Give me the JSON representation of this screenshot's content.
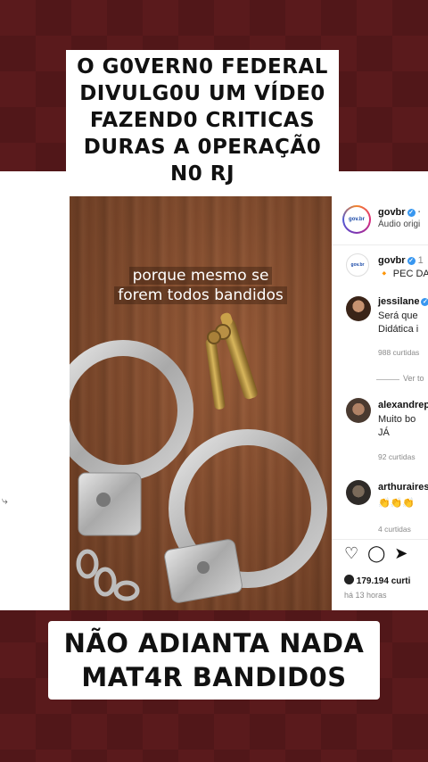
{
  "overlay": {
    "top_lines": [
      "O G0VERN0 FEDERAL",
      "DIVULG0U UM VÍDE0",
      "FAZEND0 CRITICAS",
      "DURAS A 0PERAÇÃ0",
      "N0 RJ"
    ],
    "bottom_lines": [
      "NÃO ADIANTA NADA",
      "MAT4R BANDID0S"
    ]
  },
  "video": {
    "caption_lines": [
      "porque mesmo se",
      "forem todos bandidos"
    ]
  },
  "instagram": {
    "author": {
      "username": "govbr",
      "subtitle": "Áudio origi",
      "avatar_text": "gov.br"
    },
    "caption": {
      "username": "govbr",
      "text": "PEC DA"
    },
    "comments": [
      {
        "username": "jessilane",
        "lines": [
          "Será que",
          "Didática i"
        ],
        "likes": "988 curtidas"
      },
      {
        "username": "alexandrep",
        "lines": [
          "Muito bo",
          "JÁ"
        ],
        "likes": "92 curtidas"
      },
      {
        "username": "arthuraires",
        "lines": [
          "👏👏👏"
        ],
        "likes": "4 curtidas"
      }
    ],
    "see_replies": "Ver to",
    "likes_total": "179.194 curti",
    "posted": "há 13 horas"
  },
  "colors": {
    "background": "#5a1a1c",
    "banner": "#ffffff",
    "verified": "#3897f0"
  }
}
